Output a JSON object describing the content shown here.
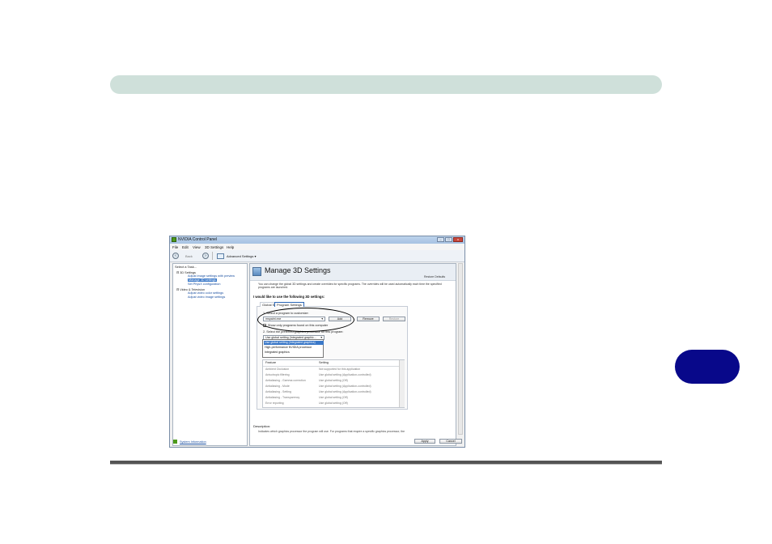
{
  "window": {
    "title": "NVIDIA Control Panel",
    "controls": {
      "minimize": "–",
      "maximize": "□",
      "close": "x"
    }
  },
  "menu": [
    "File",
    "Edit",
    "View",
    "3D Settings",
    "Help"
  ],
  "toolbar": {
    "back_label": "Back",
    "advanced_label": "Advanced Settings ▾"
  },
  "sidebar": {
    "select_task_label": "Select a Task...",
    "items": [
      {
        "label": "3D Settings",
        "level": 0
      },
      {
        "label": "Adjust image settings with preview",
        "level": 1
      },
      {
        "label": "Manage 3D settings",
        "level": 1,
        "selected": true
      },
      {
        "label": "Set PhysX configuration",
        "level": 1
      },
      {
        "label": "Video & Television",
        "level": 0
      },
      {
        "label": "Adjust video color settings",
        "level": 1
      },
      {
        "label": "Adjust video image settings",
        "level": 1
      }
    ],
    "footer_link": "System Information"
  },
  "content": {
    "title": "Manage 3D Settings",
    "restore_link": "Restore Defaults",
    "intro_text": "You can change the global 3D settings and create overrides for specific programs. The overrides will be used automatically each time the specified programs are launched.",
    "section_label": "I would like to use the following 3D settings:",
    "tabs": {
      "global": "Global Settings",
      "program": "Program Settings"
    },
    "step1_label": "1. Select a program to customize:",
    "program_value": "mspaint.exe",
    "add_button": "Add",
    "remove_button": "Remove",
    "restore_button": "Restore",
    "checkbox_label": "Show only programs found on this computer",
    "step2_label": "2. Select the preferred graphics processor for this program:",
    "processor_value": "Use global setting (Integrated graphic...",
    "dropdown_options": [
      "Use global setting (Integrated graphics)",
      "High-performance NVIDIA processor",
      "Integrated graphics"
    ],
    "table": {
      "headers": [
        "Feature",
        "Setting"
      ],
      "rows": [
        [
          "Ambient Occlusion",
          "Not supported for this application"
        ],
        [
          "Anisotropic filtering",
          "Use global setting (Application-controlled)"
        ],
        [
          "Antialiasing - Gamma correction",
          "Use global setting (Off)"
        ],
        [
          "Antialiasing - Mode",
          "Use global setting (Application-controlled)"
        ],
        [
          "Antialiasing - Setting",
          "Use global setting (Application-controlled)"
        ],
        [
          "Antialiasing - Transparency",
          "Use global setting (Off)"
        ],
        [
          "Error reporting",
          "Use global setting (Off)"
        ]
      ]
    },
    "description_label": "Description:",
    "description_text": "Indicates which graphics processor the program will use. For programs that require a specific graphics processor, the"
  },
  "bottom_buttons": {
    "apply": "Apply",
    "cancel": "Cancel"
  },
  "colors": {
    "header_bar": "#cfe0da",
    "chapter_tab": "#08088a",
    "selection": "#3a78c8"
  }
}
